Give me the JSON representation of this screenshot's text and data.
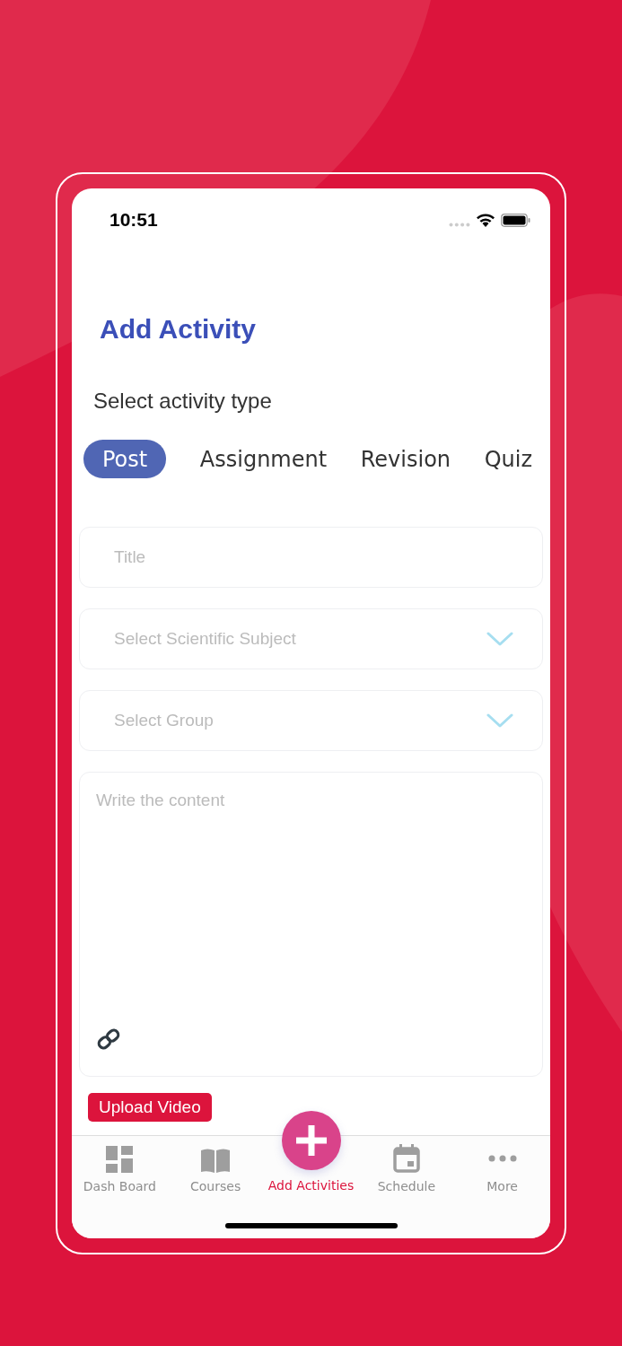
{
  "status_bar": {
    "time": "10:51"
  },
  "title": "Add Activity",
  "activity_type": {
    "label": "Select activity type",
    "tabs": [
      {
        "label": "Post",
        "selected": true
      },
      {
        "label": "Assignment",
        "selected": false
      },
      {
        "label": "Revision",
        "selected": false
      },
      {
        "label": "Quiz",
        "selected": false
      }
    ]
  },
  "fields": [
    {
      "kind": "text",
      "placeholder": "Title"
    },
    {
      "kind": "dropdown",
      "placeholder": "Select Scientific Subject"
    },
    {
      "kind": "dropdown",
      "placeholder": "Select Group"
    },
    {
      "kind": "textarea",
      "placeholder": "Write the content"
    }
  ],
  "upload_button": "Upload Video",
  "nav": [
    {
      "kind": "dashboard",
      "label": "Dash Board",
      "selected": false
    },
    {
      "kind": "courses",
      "label": "Courses",
      "selected": false
    },
    {
      "kind": "add",
      "label": "Add Activities",
      "selected": true
    },
    {
      "kind": "schedule",
      "label": "Schedule",
      "selected": false
    },
    {
      "kind": "more",
      "label": "More",
      "selected": false
    }
  ]
}
